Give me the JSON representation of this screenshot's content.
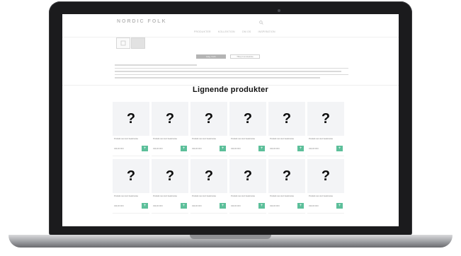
{
  "site": {
    "logo": "NORDIC FOLK",
    "nav": [
      "PRODUKTER",
      "KOLLEKTION",
      "OM OS",
      "INSPIRATION"
    ],
    "primary_button": "Læg i kurv",
    "secondary_button": "Tilføj til ønskeliste"
  },
  "related": {
    "title": "Lignende produkter",
    "products": [
      {
        "image_glyph": "?",
        "name": "Produkt navn kort beskrivelse",
        "price": "499,00 DKK",
        "add": "+"
      },
      {
        "image_glyph": "?",
        "name": "Produkt navn kort beskrivelse",
        "price": "499,00 DKK",
        "add": "+"
      },
      {
        "image_glyph": "?",
        "name": "Produkt navn kort beskrivelse",
        "price": "499,00 DKK",
        "add": "+"
      },
      {
        "image_glyph": "?",
        "name": "Produkt navn kort beskrivelse",
        "price": "499,00 DKK",
        "add": "+"
      },
      {
        "image_glyph": "?",
        "name": "Produkt navn kort beskrivelse",
        "price": "499,00 DKK",
        "add": "+"
      },
      {
        "image_glyph": "?",
        "name": "Produkt navn kort beskrivelse",
        "price": "499,00 DKK",
        "add": "+"
      },
      {
        "image_glyph": "?",
        "name": "Produkt navn kort beskrivelse",
        "price": "499,00 DKK",
        "add": "+"
      },
      {
        "image_glyph": "?",
        "name": "Produkt navn kort beskrivelse",
        "price": "499,00 DKK",
        "add": "+"
      },
      {
        "image_glyph": "?",
        "name": "Produkt navn kort beskrivelse",
        "price": "499,00 DKK",
        "add": "+"
      },
      {
        "image_glyph": "?",
        "name": "Produkt navn kort beskrivelse",
        "price": "499,00 DKK",
        "add": "+"
      },
      {
        "image_glyph": "?",
        "name": "Produkt navn kort beskrivelse",
        "price": "499,00 DKK",
        "add": "+"
      },
      {
        "image_glyph": "?",
        "name": "Produkt navn kort beskrivelse",
        "price": "499,00 DKK",
        "add": "+"
      }
    ]
  },
  "colors": {
    "laptop_frame": "#1b1b1d",
    "card_background": "#f3f4f6",
    "add_button": "#5cbf9a"
  }
}
